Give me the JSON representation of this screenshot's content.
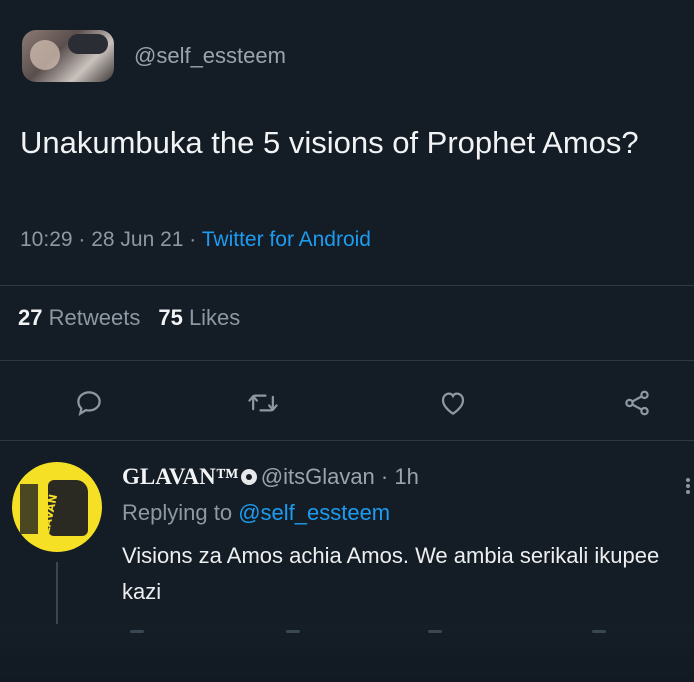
{
  "tweet": {
    "handle": "@self_essteem",
    "text": "Unakumbuka the 5 visions of Prophet Amos?",
    "time": "10:29 · 28 Jun 21 · ",
    "client": "Twitter for Android",
    "retweets_count": "27",
    "retweets_label": "Retweets",
    "likes_count": "75",
    "likes_label": "Likes"
  },
  "actions": {
    "reply_icon": "reply-icon",
    "retweet_icon": "retweet-icon",
    "like_icon": "heart-icon",
    "share_icon": "share-icon"
  },
  "reply": {
    "name": "GLAVAN™",
    "handle_time": "@itsGlavan · 1h",
    "replying_prefix": "Replying to ",
    "replying_to": "@self_essteem",
    "text": "Visions za Amos achia Amos. We ambia serikali ikupee kazi"
  },
  "colors": {
    "background": "#141d26",
    "link": "#1d9bf0",
    "muted": "#8d98a2"
  }
}
